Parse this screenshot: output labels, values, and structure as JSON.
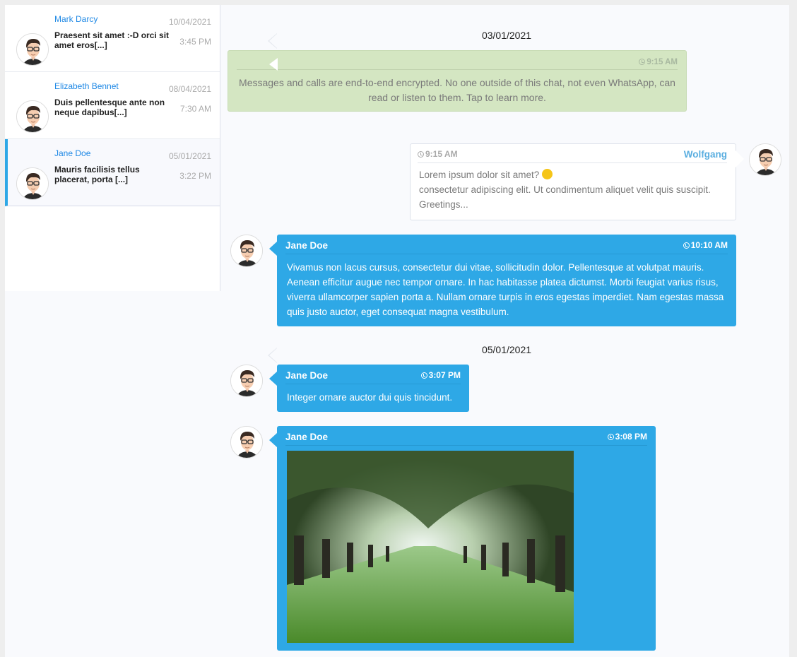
{
  "conversations": [
    {
      "name": "Mark Darcy",
      "preview": "Praesent sit amet :-D orci sit amet eros[...]",
      "date": "10/04/2021",
      "time": "3:45 PM",
      "active": false
    },
    {
      "name": "Elizabeth Bennet",
      "preview": "Duis pellentesque ante non neque dapibus[...]",
      "date": "08/04/2021",
      "time": "7:30 AM",
      "active": false
    },
    {
      "name": "Jane Doe",
      "preview": "Mauris facilisis tellus placerat, porta [...]",
      "date": "05/01/2021",
      "time": "3:22 PM",
      "active": true
    }
  ],
  "thread": {
    "date1": "03/01/2021",
    "system": {
      "time": "9:15 AM",
      "text": "Messages and calls are end-to-end encrypted. No one outside of this chat, not even WhatsApp, can read or listen to them. Tap to learn more."
    },
    "outgoing": {
      "sender": "Wolfgang",
      "time": "9:15 AM",
      "line1": "Lorem ipsum dolor sit amet?",
      "emoji": "winking-face",
      "line2": "consectetur adipiscing elit. Ut condimentum aliquet velit quis suscipit.",
      "line3": "Greetings..."
    },
    "msg1": {
      "sender": "Jane Doe",
      "time": "10:10 AM",
      "text": "Vivamus non lacus cursus, consectetur dui vitae, sollicitudin dolor. Pellentesque at volutpat mauris. Aenean efficitur augue nec tempor ornare. In hac habitasse platea dictumst. Morbi feugiat varius risus, viverra ullamcorper sapien porta a. Nullam ornare turpis in eros egestas imperdiet. Nam egestas massa quis justo auctor, eget consequat magna vestibulum."
    },
    "date2": "05/01/2021",
    "msg2": {
      "sender": "Jane Doe",
      "time": "3:07 PM",
      "text": "Integer ornare auctor dui quis tincidunt."
    },
    "msg3": {
      "sender": "Jane Doe",
      "time": "3:08 PM",
      "image": "tree-tunnel-photo"
    }
  },
  "colors": {
    "accent": "#2ea8e6",
    "system_bubble": "#d4e6c2",
    "name_link": "#1e88e5"
  }
}
